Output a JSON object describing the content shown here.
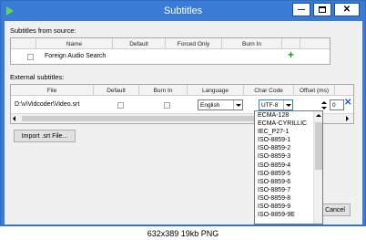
{
  "window": {
    "title": "Subtitles",
    "minimize_glyph": "—",
    "close_glyph": "✕"
  },
  "source": {
    "label": "Subtitles from source:",
    "columns": [
      "Name",
      "Default",
      "Forced Only",
      "Burn In"
    ],
    "rows": [
      {
        "name": "Foreign Audio Search",
        "default": false
      }
    ],
    "add_glyph": "+"
  },
  "external": {
    "label": "External subtitles:",
    "columns": [
      "File",
      "Default",
      "Burn In",
      "Language",
      "Char Code",
      "Offset (ms)"
    ],
    "rows": [
      {
        "file": "D:\\v\\Vidcoder\\Video.srt",
        "default": false,
        "burn_in": false,
        "language": "English",
        "char_code": "UTF-8",
        "offset": "0"
      }
    ],
    "remove_glyph": "✕"
  },
  "import_button": "Import .srt File...",
  "cancel_button": "Cancel",
  "charcode_options": [
    "ECMA-128",
    "ECMA-CYRILLIC",
    "IEC_P27-1",
    "ISO-8859-1",
    "ISO-8859-2",
    "ISO-8859-3",
    "ISO-8859-4",
    "ISO-8859-5",
    "ISO-8859-6",
    "ISO-8859-7",
    "ISO-8859-8",
    "ISO-8859-9",
    "ISO-8859-9E"
  ],
  "statusbar": "632x389 19kb PNG",
  "colors": {
    "titlebar": "#3a7bd5",
    "add_icon": "#1a9e1a",
    "remove_icon": "#1e5fb8",
    "window_bg": "#f0f0f0"
  }
}
